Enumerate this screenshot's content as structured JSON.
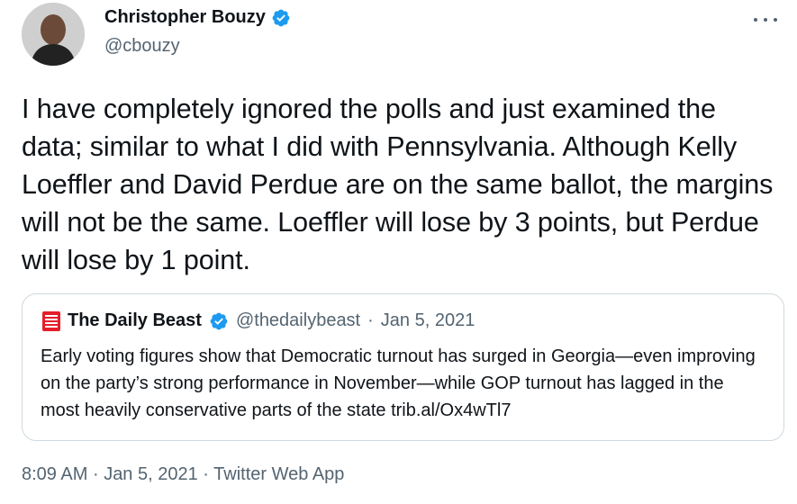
{
  "author": {
    "name": "Christopher Bouzy",
    "handle": "@cbouzy",
    "avatar_icon": "user-avatar",
    "verified": true
  },
  "tweet": {
    "text": "I have completely ignored the polls and just examined the data; similar to what I did with Pennsylvania. Although Kelly Loeffler and David Perdue are on the same ballot, the margins will not be the same. Loeffler will lose by 3 points, but Perdue will lose by 1 point."
  },
  "quote": {
    "name": "The Daily Beast",
    "handle": "@thedailybeast",
    "separator": "·",
    "date": "Jan 5, 2021",
    "text": "Early voting figures show that Democratic turnout has surged in Georgia—even improving on the party’s strong performance in November—while GOP turnout has lagged in the most heavily conservative parts of the state trib.al/Ox4wTl7",
    "logo_icon": "daily-beast-logo"
  },
  "footer": {
    "time": "8:09 AM",
    "sep1": "·",
    "date": "Jan 5, 2021",
    "sep2": "·",
    "source": "Twitter Web App"
  },
  "colors": {
    "verified_blue": "#1d9bf0",
    "secondary_text": "#536471",
    "beast_red": "#e41e2b"
  },
  "icons": {
    "more": "more-horizontal-icon",
    "verified": "verified-badge-icon"
  }
}
